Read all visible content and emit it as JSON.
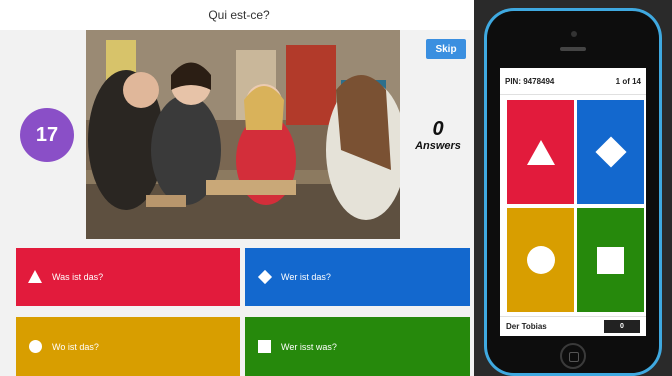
{
  "presenter": {
    "title": "Qui est-ce?",
    "timer": "17",
    "skip_label": "Skip",
    "answers_count": "0",
    "answers_label": "Answers",
    "answers": [
      {
        "label": "Was ist das?",
        "shape": "triangle-icon",
        "color": "#e21b3c"
      },
      {
        "label": "Wer ist das?",
        "shape": "diamond-icon",
        "color": "#1368ce"
      },
      {
        "label": "Wo ist das?",
        "shape": "circle-icon",
        "color": "#d89e00"
      },
      {
        "label": "Wer isst was?",
        "shape": "square-icon",
        "color": "#26890c"
      }
    ]
  },
  "phone": {
    "pin": "PIN: 9478494",
    "progress": "1 of 14",
    "player_name": "Der Tobias",
    "player_score": "0"
  },
  "colors": {
    "timer_purple": "#8a4fc7",
    "skip_blue": "#3a8fe0",
    "phone_frame": "#3fa9e0"
  }
}
